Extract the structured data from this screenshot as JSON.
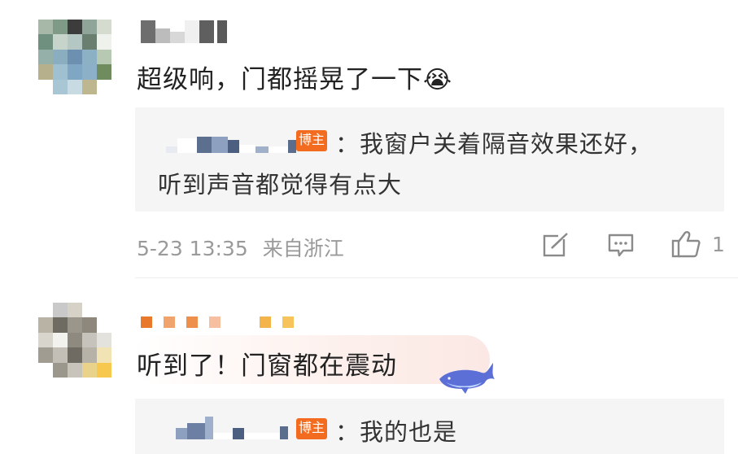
{
  "comments": [
    {
      "text": "超级响，门都摇晃了一下",
      "emoji": "😭",
      "reply": {
        "badge": "博主",
        "text_line1": "：我窗户关着隔音效果还好，",
        "text_line2": "听到声音都觉得有点大"
      },
      "meta": {
        "time": "5-23 13:35",
        "location": "来自浙江",
        "like_count": "1"
      },
      "icons": [
        "share-icon",
        "comment-icon",
        "like-icon"
      ]
    },
    {
      "text": "听到了！门窗都在震动",
      "reply": {
        "badge": "博主",
        "text": "：我的也是"
      }
    }
  ],
  "colors": {
    "badge": "#f26b1f",
    "reply_bg": "#f5f5f5",
    "meta": "#9a9a9a"
  }
}
